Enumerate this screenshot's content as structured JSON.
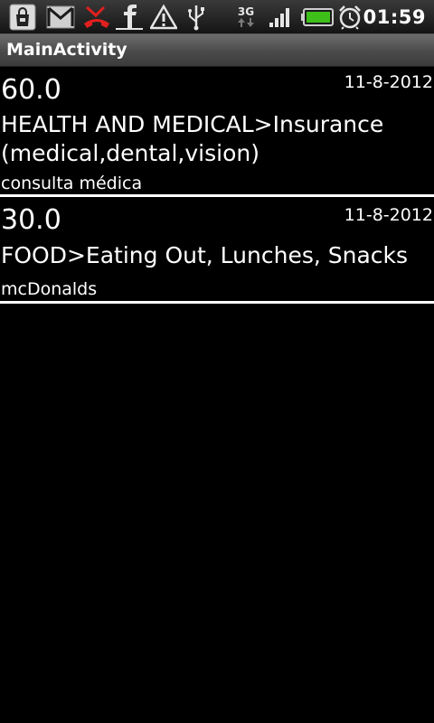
{
  "status_bar": {
    "icons": [
      "shopping-bag-icon",
      "gmail-icon",
      "missed-call-icon",
      "facebook-icon",
      "warning-icon",
      "usb-icon",
      "3g-icon",
      "signal-icon",
      "battery-icon",
      "alarm-icon"
    ],
    "network_label": "3G",
    "time": "01:59",
    "battery_color": "#3fbf1a"
  },
  "title_bar": {
    "title": "MainActivity"
  },
  "expenses": [
    {
      "amount": "60.0",
      "date": "11-8-2012",
      "category": "HEALTH AND MEDICAL>Insurance (medical,dental,vision)",
      "note": "consulta médica"
    },
    {
      "amount": "30.0",
      "date": "11-8-2012",
      "category": "FOOD>Eating Out, Lunches, Snacks",
      "note": "mcDonalds"
    }
  ],
  "colors": {
    "background": "#000000",
    "text": "#ffffff",
    "divider": "#ffffff",
    "missed_call_red": "#e0201e"
  }
}
